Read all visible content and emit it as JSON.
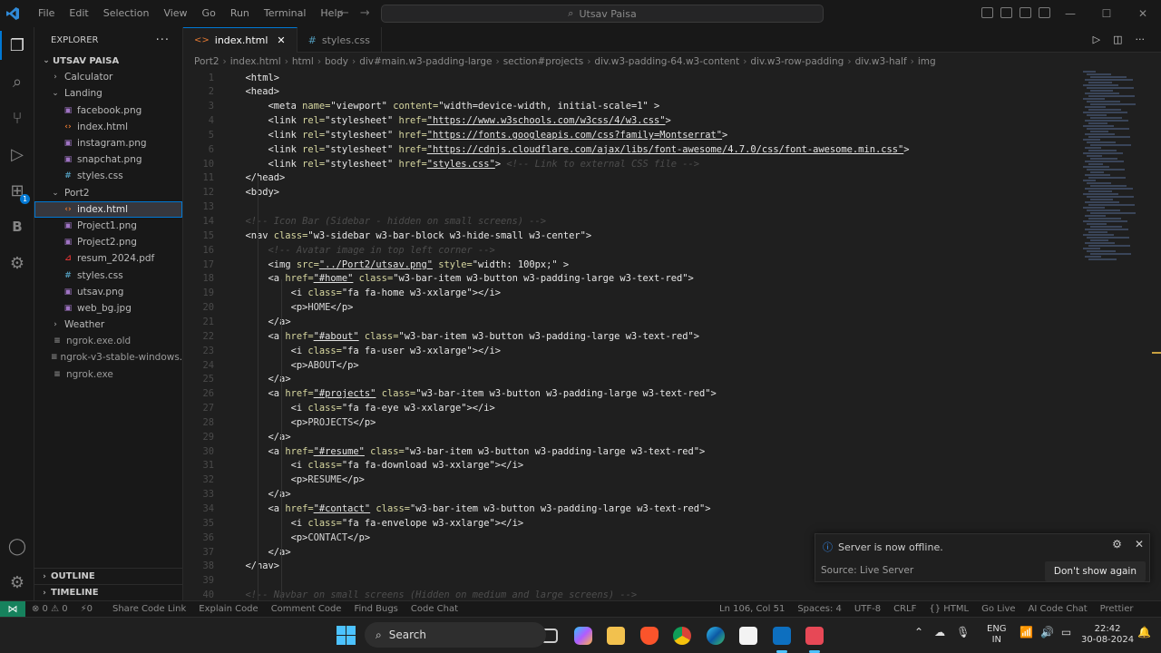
{
  "menu": [
    "File",
    "Edit",
    "Selection",
    "View",
    "Go",
    "Run",
    "Terminal",
    "Help"
  ],
  "search_text": "Utsav Paisa",
  "explorer": {
    "title": "EXPLORER",
    "root": "UTSAV PAISA",
    "items": [
      {
        "label": "Calculator",
        "kind": "folder"
      },
      {
        "label": "Landing",
        "kind": "folder-open"
      },
      {
        "label": "facebook.png",
        "kind": "png"
      },
      {
        "label": "index.html",
        "kind": "html"
      },
      {
        "label": "instagram.png",
        "kind": "png"
      },
      {
        "label": "snapchat.png",
        "kind": "png"
      },
      {
        "label": "styles.css",
        "kind": "css"
      },
      {
        "label": "Port2",
        "kind": "folder-open"
      },
      {
        "label": "index.html",
        "kind": "html"
      },
      {
        "label": "Project1.png",
        "kind": "png"
      },
      {
        "label": "Project2.png",
        "kind": "png"
      },
      {
        "label": "resum_2024.pdf",
        "kind": "pdf"
      },
      {
        "label": "styles.css",
        "kind": "css"
      },
      {
        "label": "utsav.png",
        "kind": "png"
      },
      {
        "label": "web_bg.jpg",
        "kind": "png"
      },
      {
        "label": "Weather",
        "kind": "folder"
      },
      {
        "label": "ngrok.exe.old",
        "kind": "file"
      },
      {
        "label": "ngrok-v3-stable-windows...",
        "kind": "file"
      },
      {
        "label": "ngrok.exe",
        "kind": "file"
      }
    ],
    "outline": "OUTLINE",
    "timeline": "TIMELINE"
  },
  "tabs": [
    {
      "label": "index.html",
      "active": true
    },
    {
      "label": "styles.css",
      "active": false
    }
  ],
  "breadcrumb": [
    "Port2",
    "index.html",
    "html",
    "body",
    "div#main.w3-padding-large",
    "section#projects",
    "div.w3-padding-64.w3-content",
    "div.w3-row-padding",
    "div.w3-half",
    "img"
  ],
  "code": [
    {
      "n": "1",
      "s": [
        [
          "t",
          "<html>"
        ]
      ],
      "i": 2
    },
    {
      "n": "2",
      "s": [
        [
          "t",
          "<head>"
        ]
      ],
      "i": 2
    },
    {
      "n": "3",
      "s": [
        [
          "t",
          "<meta "
        ],
        [
          "a",
          "name="
        ],
        [
          "q",
          "\"viewport\""
        ],
        [
          "a",
          " content="
        ],
        [
          "q",
          "\"width=device-width, initial-scale=1\""
        ],
        [
          "t",
          " >"
        ]
      ],
      "i": 4
    },
    {
      "n": "4",
      "s": [
        [
          "t",
          "<link "
        ],
        [
          "a",
          "rel="
        ],
        [
          "q",
          "\"stylesheet\""
        ],
        [
          "a",
          " href="
        ],
        [
          "u",
          "\"https://www.w3schools.com/w3css/4/w3.css\""
        ],
        [
          "t",
          ">"
        ]
      ],
      "i": 4
    },
    {
      "n": "5",
      "s": [
        [
          "t",
          "<link "
        ],
        [
          "a",
          "rel="
        ],
        [
          "q",
          "\"stylesheet\""
        ],
        [
          "a",
          " href="
        ],
        [
          "u",
          "\"https://fonts.googleapis.com/css?family=Montserrat\""
        ],
        [
          "t",
          ">"
        ]
      ],
      "i": 4
    },
    {
      "n": "6",
      "s": [
        [
          "t",
          "<link "
        ],
        [
          "a",
          "rel="
        ],
        [
          "q",
          "\"stylesheet\""
        ],
        [
          "a",
          " href="
        ],
        [
          "u",
          "\"https://cdnjs.cloudflare.com/ajax/libs/font-awesome/4.7.0/css/font-awesome.min.css\""
        ],
        [
          "t",
          ">"
        ]
      ],
      "i": 4
    },
    {
      "n": "10",
      "s": [
        [
          "t",
          "<link "
        ],
        [
          "a",
          "rel="
        ],
        [
          "q",
          "\"stylesheet\""
        ],
        [
          "a",
          " href="
        ],
        [
          "u",
          "\"styles.css\""
        ],
        [
          "t",
          "> "
        ],
        [
          "c",
          "<!-- Link to external CSS file -->"
        ]
      ],
      "i": 4
    },
    {
      "n": "11",
      "s": [
        [
          "t",
          "</head>"
        ]
      ],
      "i": 2
    },
    {
      "n": "12",
      "s": [
        [
          "t",
          "<body>"
        ]
      ],
      "i": 2
    },
    {
      "n": "13",
      "s": [],
      "i": 0
    },
    {
      "n": "14",
      "s": [
        [
          "c",
          "<!-- Icon Bar (Sidebar - hidden on small screens) -->"
        ]
      ],
      "i": 2
    },
    {
      "n": "15",
      "s": [
        [
          "t",
          "<nav "
        ],
        [
          "a",
          "class="
        ],
        [
          "q",
          "\"w3-sidebar w3-bar-block w3-hide-small w3-center\""
        ],
        [
          "t",
          ">"
        ]
      ],
      "i": 2
    },
    {
      "n": "16",
      "s": [
        [
          "c",
          "<!-- Avatar image in top left corner -->"
        ]
      ],
      "i": 4
    },
    {
      "n": "17",
      "s": [
        [
          "t",
          "<img "
        ],
        [
          "a",
          "src="
        ],
        [
          "u",
          "\"../Port2/utsav.png\""
        ],
        [
          "a",
          " style="
        ],
        [
          "q",
          "\"width: 100px;\""
        ],
        [
          "t",
          " >"
        ]
      ],
      "i": 4
    },
    {
      "n": "18",
      "s": [
        [
          "t",
          "<a "
        ],
        [
          "a",
          "href="
        ],
        [
          "u",
          "\"#home\""
        ],
        [
          "a",
          " class="
        ],
        [
          "q",
          "\"w3-bar-item w3-button w3-padding-large w3-text-red\""
        ],
        [
          "t",
          ">"
        ]
      ],
      "i": 4
    },
    {
      "n": "19",
      "s": [
        [
          "t",
          "<i "
        ],
        [
          "a",
          "class="
        ],
        [
          "q",
          "\"fa fa-home w3-xxlarge\""
        ],
        [
          "t",
          "></i>"
        ]
      ],
      "i": 6
    },
    {
      "n": "20",
      "s": [
        [
          "t",
          "<p>"
        ],
        [
          "x",
          "HOME"
        ],
        [
          "t",
          "</p>"
        ]
      ],
      "i": 6
    },
    {
      "n": "21",
      "s": [
        [
          "t",
          "</a>"
        ]
      ],
      "i": 4
    },
    {
      "n": "22",
      "s": [
        [
          "t",
          "<a "
        ],
        [
          "a",
          "href="
        ],
        [
          "u",
          "\"#about\""
        ],
        [
          "a",
          " class="
        ],
        [
          "q",
          "\"w3-bar-item w3-button w3-padding-large w3-text-red\""
        ],
        [
          "t",
          ">"
        ]
      ],
      "i": 4
    },
    {
      "n": "23",
      "s": [
        [
          "t",
          "<i "
        ],
        [
          "a",
          "class="
        ],
        [
          "q",
          "\"fa fa-user w3-xxlarge\""
        ],
        [
          "t",
          "></i>"
        ]
      ],
      "i": 6
    },
    {
      "n": "24",
      "s": [
        [
          "t",
          "<p>"
        ],
        [
          "x",
          "ABOUT"
        ],
        [
          "t",
          "</p>"
        ]
      ],
      "i": 6
    },
    {
      "n": "25",
      "s": [
        [
          "t",
          "</a>"
        ]
      ],
      "i": 4
    },
    {
      "n": "26",
      "s": [
        [
          "t",
          "<a "
        ],
        [
          "a",
          "href="
        ],
        [
          "u",
          "\"#projects\""
        ],
        [
          "a",
          " class="
        ],
        [
          "q",
          "\"w3-bar-item w3-button w3-padding-large w3-text-red\""
        ],
        [
          "t",
          ">"
        ]
      ],
      "i": 4
    },
    {
      "n": "27",
      "s": [
        [
          "t",
          "<i "
        ],
        [
          "a",
          "class="
        ],
        [
          "q",
          "\"fa fa-eye w3-xxlarge\""
        ],
        [
          "t",
          "></i>"
        ]
      ],
      "i": 6
    },
    {
      "n": "28",
      "s": [
        [
          "t",
          "<p>"
        ],
        [
          "x",
          "PROJECTS"
        ],
        [
          "t",
          "</p>"
        ]
      ],
      "i": 6
    },
    {
      "n": "29",
      "s": [
        [
          "t",
          "</a>"
        ]
      ],
      "i": 4
    },
    {
      "n": "30",
      "s": [
        [
          "t",
          "<a "
        ],
        [
          "a",
          "href="
        ],
        [
          "u",
          "\"#resume\""
        ],
        [
          "a",
          " class="
        ],
        [
          "q",
          "\"w3-bar-item w3-button w3-padding-large w3-text-red\""
        ],
        [
          "t",
          ">"
        ]
      ],
      "i": 4
    },
    {
      "n": "31",
      "s": [
        [
          "t",
          "<i "
        ],
        [
          "a",
          "class="
        ],
        [
          "q",
          "\"fa fa-download w3-xxlarge\""
        ],
        [
          "t",
          "></i>"
        ]
      ],
      "i": 6
    },
    {
      "n": "32",
      "s": [
        [
          "t",
          "<p>"
        ],
        [
          "x",
          "RESUME"
        ],
        [
          "t",
          "</p>"
        ]
      ],
      "i": 6
    },
    {
      "n": "33",
      "s": [
        [
          "t",
          "</a>"
        ]
      ],
      "i": 4
    },
    {
      "n": "34",
      "s": [
        [
          "t",
          "<a "
        ],
        [
          "a",
          "href="
        ],
        [
          "u",
          "\"#contact\""
        ],
        [
          "a",
          " class="
        ],
        [
          "q",
          "\"w3-bar-item w3-button w3-padding-large w3-text-red\""
        ],
        [
          "t",
          ">"
        ]
      ],
      "i": 4
    },
    {
      "n": "35",
      "s": [
        [
          "t",
          "<i "
        ],
        [
          "a",
          "class="
        ],
        [
          "q",
          "\"fa fa-envelope w3-xxlarge\""
        ],
        [
          "t",
          "></i>"
        ]
      ],
      "i": 6
    },
    {
      "n": "36",
      "s": [
        [
          "t",
          "<p>"
        ],
        [
          "x",
          "CONTACT"
        ],
        [
          "t",
          "</p>"
        ]
      ],
      "i": 6
    },
    {
      "n": "37",
      "s": [
        [
          "t",
          "</a>"
        ]
      ],
      "i": 4
    },
    {
      "n": "38",
      "s": [
        [
          "t",
          "</nav>"
        ]
      ],
      "i": 2
    },
    {
      "n": "39",
      "s": [],
      "i": 0
    },
    {
      "n": "40",
      "s": [
        [
          "c",
          "<!-- Navbar on small screens (Hidden on medium and large screens) -->"
        ]
      ],
      "i": 2
    }
  ],
  "toast": {
    "message": "Server is now offline.",
    "source": "Source: Live Server",
    "button": "Don't show again"
  },
  "status_left": [
    "⊗ 0  ⚠ 0",
    "⚡0",
    "Share Code Link",
    "Explain Code",
    "Comment Code",
    "Find Bugs",
    "Code Chat"
  ],
  "status_right": [
    "Ln 106, Col 51",
    "Spaces: 4",
    "UTF-8",
    "CRLF",
    "{} HTML",
    "Go Live",
    "AI Code Chat",
    "Prettier"
  ],
  "taskbar": {
    "search": "Search",
    "lang_top": "ENG",
    "lang_bottom": "IN",
    "time": "22:42",
    "date": "30-08-2024"
  },
  "colors": {
    "accent": "#0078d4",
    "remote": "#16825d"
  }
}
